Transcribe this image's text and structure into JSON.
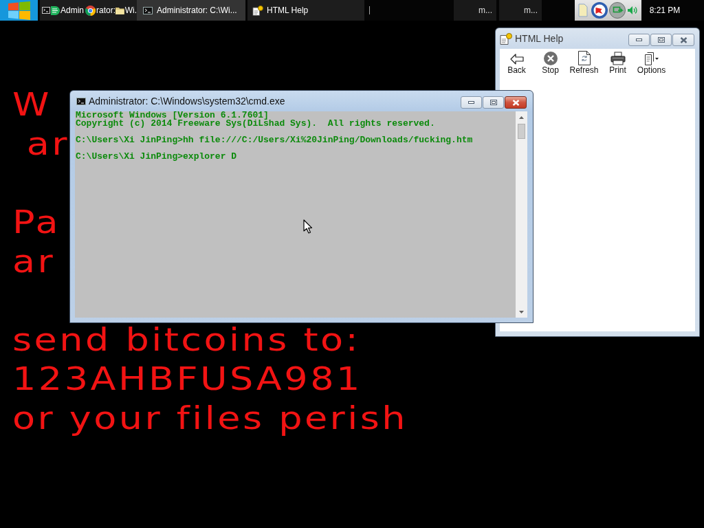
{
  "taskbar": {
    "buttons": [
      {
        "kind": "stacked",
        "selected": false,
        "label": "Admin"
      },
      {
        "kind": "browser",
        "selected": false,
        "label": "rator:"
      },
      {
        "kind": "explorer",
        "selected": false,
        "label": "Wi."
      },
      {
        "kind": "console",
        "selected": true,
        "label": "Administrator: C:\\Wi..."
      },
      {
        "kind": "help",
        "selected": false,
        "label": "HTML Help"
      },
      {
        "kind": "minimal",
        "selected": false,
        "label": "m..."
      },
      {
        "kind": "minimal",
        "selected": false,
        "label": "m..."
      }
    ],
    "clock": "8:21 PM"
  },
  "desktop": {
    "message": [
      [
        "W",
        " ar"
      ],
      [
        "Pa",
        "ar"
      ],
      [
        "send bitcoins to:",
        "123AHBFUSA981",
        "or your files perish"
      ]
    ]
  },
  "windows": [
    {
      "kind": "help",
      "title": "HTML Help",
      "active": false,
      "toolbar": [
        {
          "label": "Back"
        },
        {
          "label": "Stop"
        },
        {
          "label": "Refresh"
        },
        {
          "label": "Print"
        },
        {
          "label": "Options"
        }
      ]
    },
    {
      "kind": "console",
      "title": "Administrator: C:\\Windows\\system32\\cmd.exe",
      "active": true,
      "output": [
        [
          "Microsoft Windows [Version 6.1.7601]",
          "Copyright (c) 2014 Freeware Sys(DiLshad Sys).  All rights reserved."
        ],
        [
          "C:\\Users\\Xi JinPing>hh file:///C:/Users/Xi%20JinPing/Downloads/fucking.htm"
        ],
        [
          "C:\\Users\\Xi JinPing>explorer D"
        ]
      ]
    }
  ]
}
